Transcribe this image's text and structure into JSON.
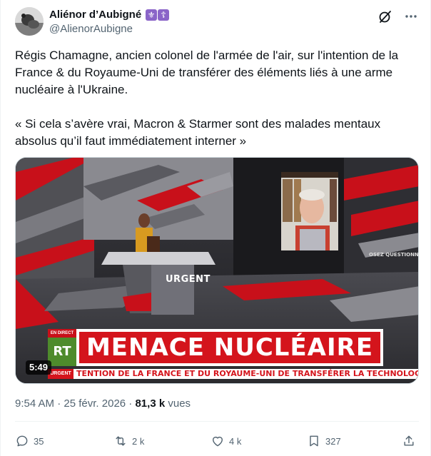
{
  "author": {
    "display_name": "Aliénor d’Aubigné",
    "badge_1": "⚜",
    "badge_2": "☦",
    "handle": "@AlienorAubigne"
  },
  "header_icons": [
    "grok-icon",
    "more-icon"
  ],
  "tweet": {
    "paragraph_1": "Régis Chamagne, ancien colonel de l'armée de l'air, sur l'intention de la France & du Royaume-Uni de transférer des éléments liés à une arme nucléaire à l'Ukraine.",
    "paragraph_2": "« Si cela s’avère vrai, Macron & Starmer sont des malades mentaux absolus qu’il faut immédiatement interner »"
  },
  "video": {
    "duration": "5:49",
    "live_label": "EN DIRECT",
    "channel_logo": "RT",
    "headline": "MENACE NUCLÉAIRE",
    "urgent_label": "URGENT",
    "floor_text": "URGENT",
    "ticker": "TENTION DE LA FRANCE ET DU ROYAUME-UNI DE TRANSFÉRER LA TECHNOLOGI"
  },
  "meta": {
    "time": "9:54 AM",
    "separator": "·",
    "date": "25 févr. 2026",
    "views_count": "81,3 k",
    "views_label": "vues"
  },
  "actions": {
    "replies": "35",
    "reposts": "2 k",
    "likes": "4 k",
    "bookmarks": "327"
  },
  "colors": {
    "text": "#0f1419",
    "secondary": "#536471",
    "rt_red": "#d4141c",
    "rt_green": "#4e8b2c",
    "badge_purple": "#8a64c8"
  }
}
